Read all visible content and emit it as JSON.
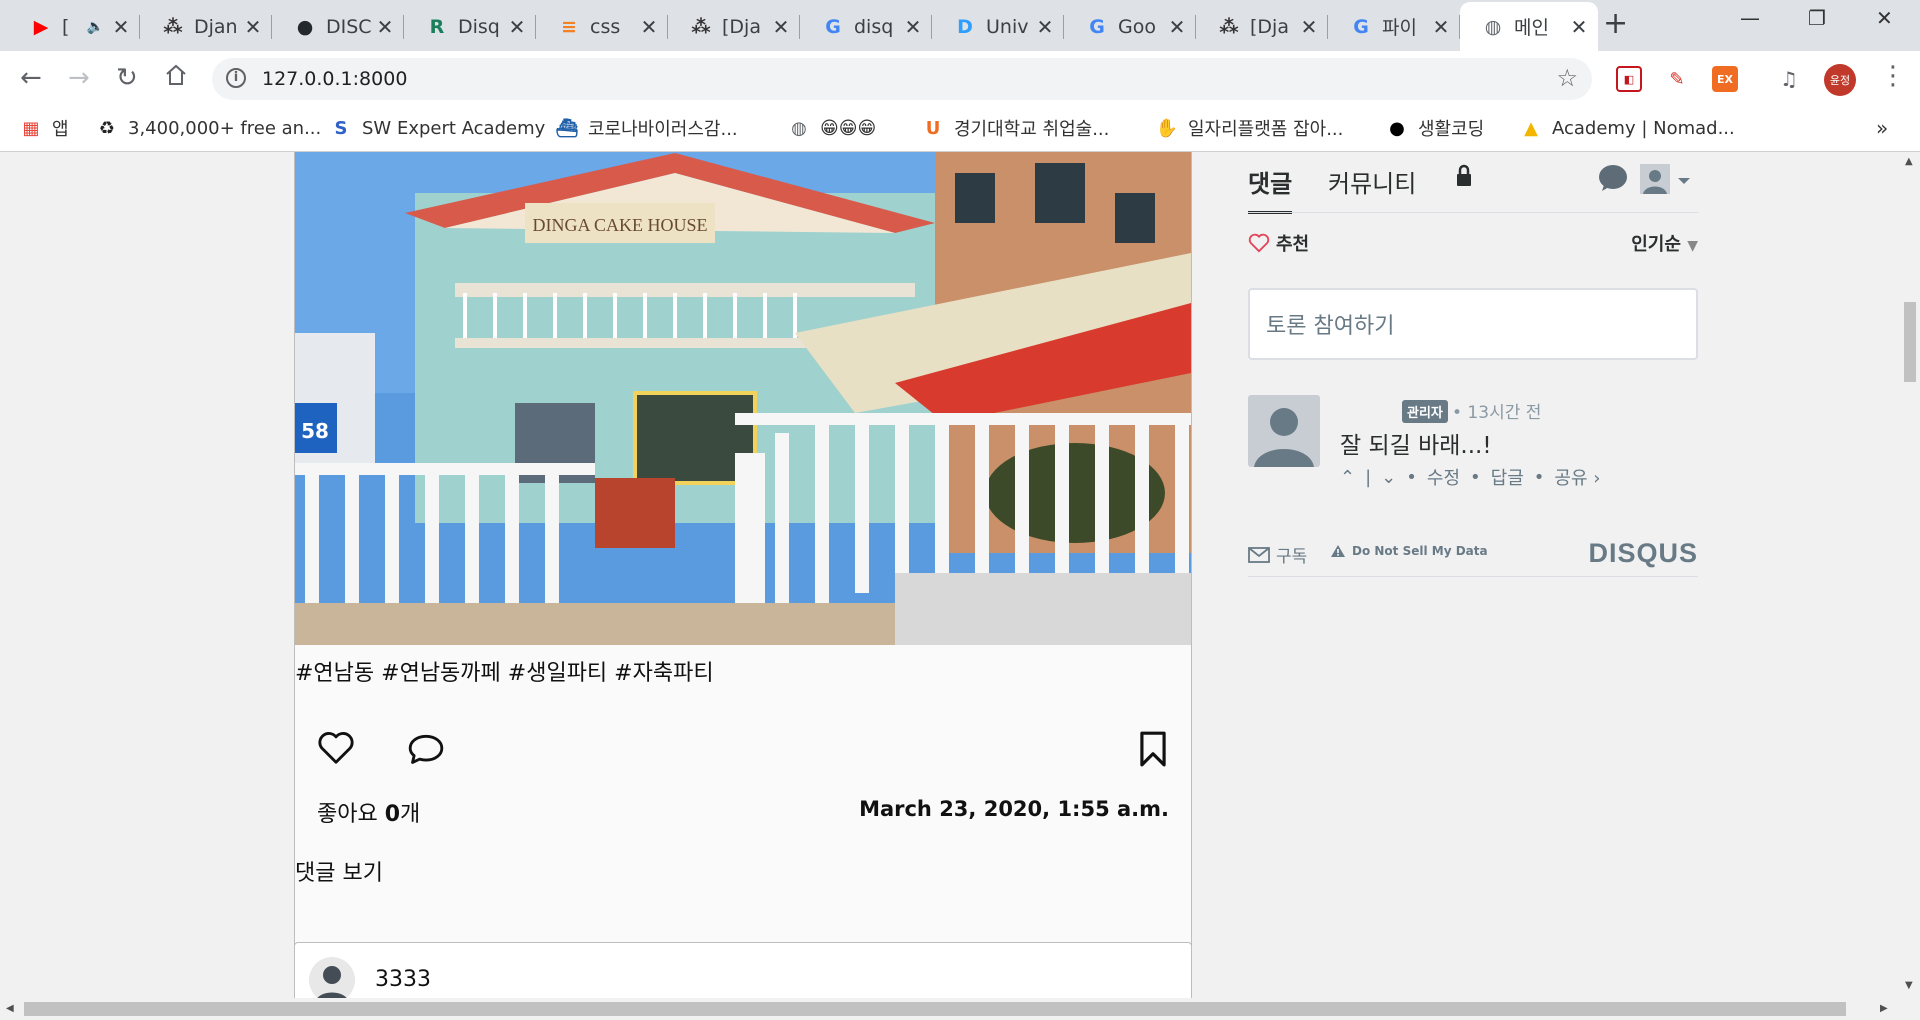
{
  "browser": {
    "tabs": [
      {
        "title": "[",
        "icon": "youtube-icon",
        "color": "#ff0000",
        "audio": true
      },
      {
        "title": "Djan",
        "icon": "dots-icon",
        "color": "#333333"
      },
      {
        "title": "DISC",
        "icon": "github-icon",
        "color": "#24292e"
      },
      {
        "title": "Disq",
        "icon": "r-icon",
        "color": "#1b7f5b"
      },
      {
        "title": "css",
        "icon": "stackoverflow-icon",
        "color": "#f48024"
      },
      {
        "title": "[Dja",
        "icon": "dots-icon",
        "color": "#333333"
      },
      {
        "title": "disq",
        "icon": "google-icon",
        "color": "#4285f4"
      },
      {
        "title": "Univ",
        "icon": "d-icon",
        "color": "#2e9fff"
      },
      {
        "title": "Goo",
        "icon": "translate-icon",
        "color": "#4285f4"
      },
      {
        "title": "[Dja",
        "icon": "dots-icon",
        "color": "#333333"
      },
      {
        "title": "파이",
        "icon": "google-icon",
        "color": "#4285f4"
      },
      {
        "title": "메인",
        "icon": "globe-icon",
        "color": "#5f6368",
        "active": true
      }
    ],
    "url": "127.0.0.1:8000",
    "profile_initials": "윤정",
    "extensions": [
      {
        "label": "◧",
        "color": "#c4161c"
      },
      {
        "label": "✎",
        "color": "#d93025"
      },
      {
        "label": "EX",
        "color": "#ef6c22"
      }
    ],
    "bookmarks": [
      {
        "label": "앱",
        "icon": "apps-grid-icon"
      },
      {
        "label": "3,400,000+ free an...",
        "icon": "recycle-icon"
      },
      {
        "label": "SW Expert Academy",
        "icon": "s-icon"
      },
      {
        "label": "코로나바이러스감...",
        "icon": "ship-icon"
      },
      {
        "label": "😁😁😁",
        "icon": "globe-icon"
      },
      {
        "label": "경기대학교 취업술...",
        "icon": "u-icon"
      },
      {
        "label": "일자리플랫폼 잡아...",
        "icon": "hand-icon"
      },
      {
        "label": "생활코딩",
        "icon": "circle-icon"
      },
      {
        "label": "Academy | Nomad...",
        "icon": "m-icon"
      }
    ],
    "bookmarks_more": "»"
  },
  "post": {
    "hashtags": "#연남동 #연남동까페 #생일파티 #자축파티",
    "likes_prefix": "좋아요 ",
    "likes_count": "0",
    "likes_suffix": "개",
    "date": "March 23, 2020, 1:55 a.m.",
    "view_comments": "댓글 보기",
    "image_sign": "DINGA CAKE HOUSE",
    "image_number": "58"
  },
  "post2": {
    "username": "3333"
  },
  "disqus": {
    "tab_comments": "댓글",
    "tab_community": "커뮤니티",
    "recommend": "추천",
    "sort": "인기순",
    "input_placeholder": "토론 참여하기",
    "comment": {
      "badge": "관리자",
      "time": "• 13시간 전",
      "text": "잘 되길 바래...!",
      "actions": [
        "수정",
        "답글",
        "공유 ›"
      ]
    },
    "subscribe": "구독",
    "do_not_sell": "Do Not Sell My Data",
    "logo": "DISQUS"
  }
}
